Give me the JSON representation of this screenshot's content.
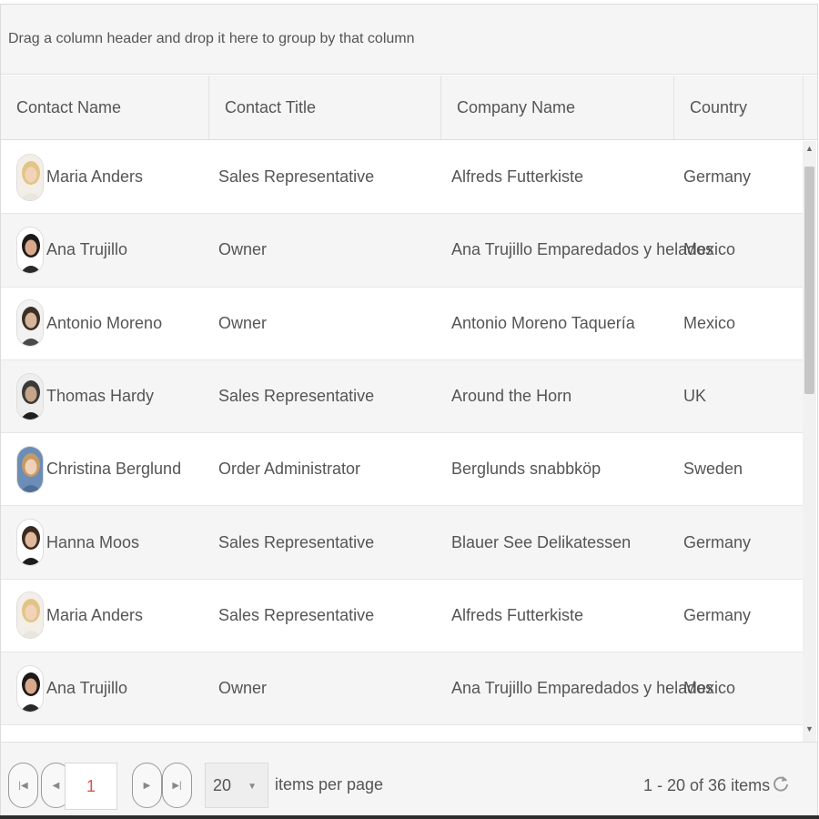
{
  "group_panel": {
    "text": "Drag a column header and drop it here to group by that column"
  },
  "columns": [
    "Contact Name",
    "Contact Title",
    "Company Name",
    "Country"
  ],
  "rows": [
    {
      "name": "Maria Anders",
      "title": "Sales Representative",
      "company": "Alfreds Futterkiste",
      "country": "Germany",
      "avatar": "avatar-blonde"
    },
    {
      "name": "Ana Trujillo",
      "title": "Owner",
      "company": "Ana Trujillo Emparedados y helados",
      "country": "Mexico",
      "avatar": "avatar-darkhair"
    },
    {
      "name": "Antonio Moreno",
      "title": "Owner",
      "company": "Antonio Moreno Taquería",
      "country": "Mexico",
      "avatar": "avatar-man"
    },
    {
      "name": "Thomas Hardy",
      "title": "Sales Representative",
      "company": "Around the Horn",
      "country": "UK",
      "avatar": "avatar-man-dark"
    },
    {
      "name": "Christina Berglund",
      "title": "Order Administrator",
      "company": "Berglunds snabbköp",
      "country": "Sweden",
      "avatar": "avatar-blue"
    },
    {
      "name": "Hanna Moos",
      "title": "Sales Representative",
      "company": "Blauer See Delikatessen",
      "country": "Germany",
      "avatar": "avatar-woman-dark"
    },
    {
      "name": "Maria Anders",
      "title": "Sales Representative",
      "company": "Alfreds Futterkiste",
      "country": "Germany",
      "avatar": "avatar-blonde"
    },
    {
      "name": "Ana Trujillo",
      "title": "Owner",
      "company": "Ana Trujillo Emparedados y helados",
      "country": "Mexico",
      "avatar": "avatar-darkhair"
    }
  ],
  "pager": {
    "current_page": "1",
    "page_size": "20",
    "items_per_page_label": "items per page",
    "info": "1 - 20 of 36 items",
    "first_icon": "first-page-icon",
    "prev_icon": "previous-page-icon",
    "next_icon": "next-page-icon",
    "last_icon": "last-page-icon",
    "refresh_icon": "refresh-icon"
  },
  "colors": {
    "accent": "#d9534f",
    "header_bg": "#f5f5f5",
    "alt_row_bg": "#f5f5f5",
    "border": "#dcdcdc"
  }
}
